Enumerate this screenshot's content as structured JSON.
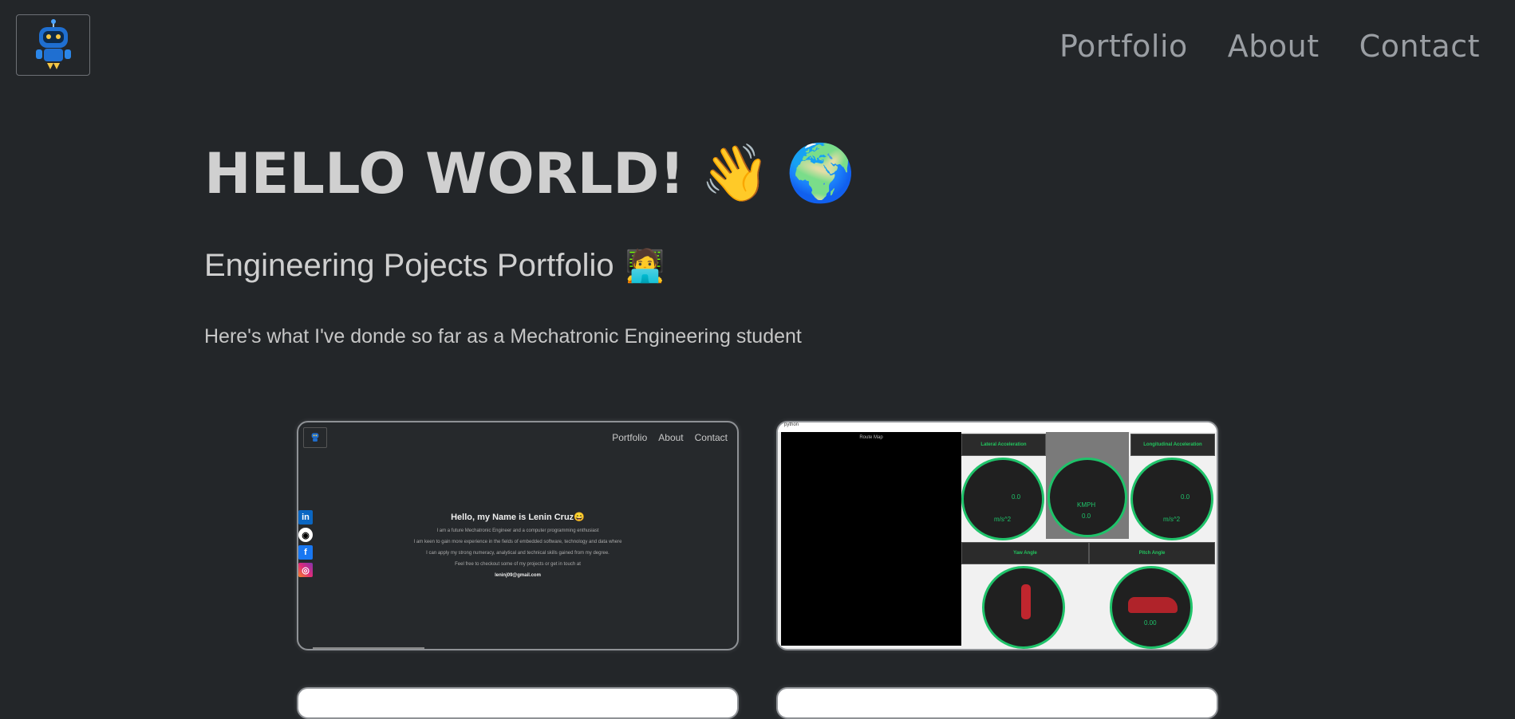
{
  "header": {
    "logo_alt": "robot-logo",
    "nav": [
      {
        "label": "Portfolio"
      },
      {
        "label": "About"
      },
      {
        "label": "Contact"
      }
    ]
  },
  "hero": {
    "title": "HELLO WORLD!",
    "title_emojis": [
      "👋",
      "🌍"
    ],
    "subtitle": "Engineering Pojects Portfolio",
    "subtitle_emoji": "🧑‍💻",
    "lead": "Here's what I've donde so far as a Mechatronic Engineering student"
  },
  "projects": [
    {
      "preview": {
        "nav": [
          "Portfolio",
          "About",
          "Contact"
        ],
        "heading_prefix": "Hello, my Name is ",
        "heading_name": "Lenin Cruz",
        "heading_emoji": "😄",
        "lines": [
          "I am a future Mechatronic Engineer and a computer programming enthusiast",
          "I am keen to gain more experience in the fields of embedded software, technology and data where",
          "I can apply my strong numeracy, analytical and technical skills gained from my degree.",
          "Feel free to checkout some of my projects or get in touch at"
        ],
        "email": "leninj09@gmail.com",
        "social": [
          "in",
          "◉",
          "f",
          "◎"
        ]
      }
    },
    {
      "preview": {
        "window_title": "python",
        "route_title": "Route Map",
        "labels": {
          "lateral": "Lateral Acceleration",
          "longitudinal": "Longitudinal Acceleration",
          "yaw": "Yaw Angle",
          "pitch": "Pitch Angle"
        },
        "gauge_values": {
          "lateral": "0.0",
          "speed_unit": "KMPH",
          "speed": "0.0",
          "longitudinal": "0.0",
          "accel_unit": "m/s^2",
          "pitch": "0.00"
        }
      }
    }
  ],
  "colors": {
    "background": "#232629",
    "nav_text": "#9a9ea3",
    "gauge_accent": "#1fc36a"
  }
}
